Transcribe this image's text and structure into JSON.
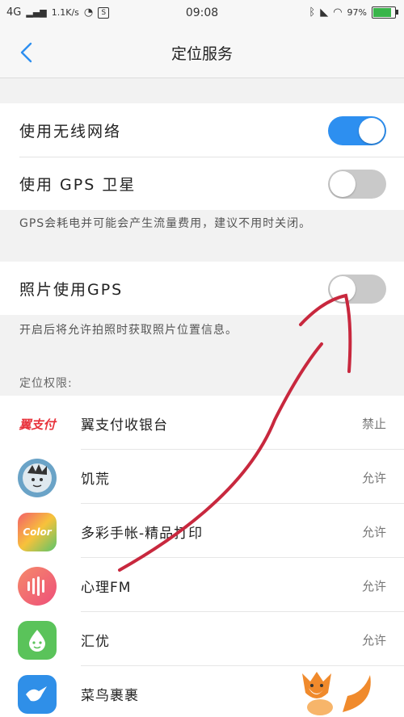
{
  "status_bar": {
    "network": "4G",
    "speed": "1.1K/s",
    "time": "09:08",
    "battery": "97%"
  },
  "header": {
    "title": "定位服务"
  },
  "settings": {
    "wifi_network": {
      "label": "使用无线网络",
      "enabled": true
    },
    "gps_satellite": {
      "label": "使用 GPS 卫星",
      "enabled": false
    },
    "gps_note": "GPS会耗电并可能会产生流量费用，建议不用时关闭。",
    "photo_gps": {
      "label": "照片使用GPS",
      "enabled": false
    },
    "photo_note": "开启后将允许拍照时获取照片位置信息。"
  },
  "permissions": {
    "header": "定位权限:",
    "apps": [
      {
        "name": "翼支付收银台",
        "status": "禁止",
        "icon": "yizhifu-logo",
        "icon_text": "翼支付",
        "color": "#e8333c"
      },
      {
        "name": "饥荒",
        "status": "允许",
        "icon": "dont-starve-icon",
        "color": "#6aa3c7"
      },
      {
        "name": "多彩手帐-精品打印",
        "status": "允许",
        "icon": "color-notebook-icon",
        "icon_text": "Color",
        "color": "#f0a63a"
      },
      {
        "name": "心理FM",
        "status": "允许",
        "icon": "xinli-fm-icon",
        "color": "#f26a6e"
      },
      {
        "name": "汇优",
        "status": "允许",
        "icon": "huiyou-icon",
        "color": "#5ac35a"
      },
      {
        "name": "菜鸟裹裹",
        "status": "",
        "icon": "cainiao-icon",
        "color": "#2f8fe8"
      }
    ]
  }
}
